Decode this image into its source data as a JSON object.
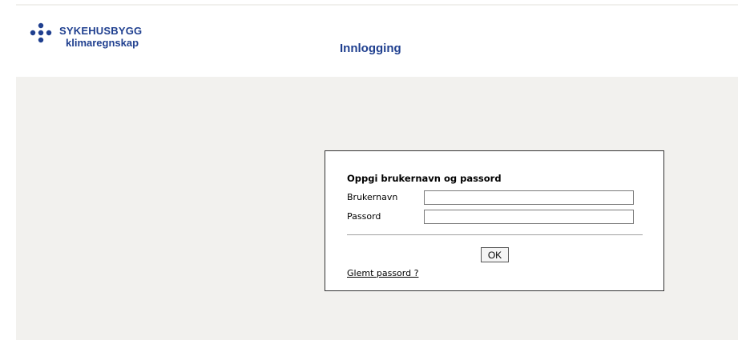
{
  "header": {
    "logo": {
      "line1": "SYKEHUSBYGG",
      "line2": "klimaregnskap",
      "icon": "dots-logo-icon"
    },
    "title": "Innlogging"
  },
  "login": {
    "heading": "Oppgi brukernavn og passord",
    "username_label": "Brukernavn",
    "username_value": "",
    "password_label": "Passord",
    "password_value": "",
    "ok_label": "OK",
    "forgot_link": "Glemt passord ?"
  },
  "colors": {
    "brand": "#1f3f8f",
    "background": "#f2f1ee",
    "box_border": "#333333"
  }
}
